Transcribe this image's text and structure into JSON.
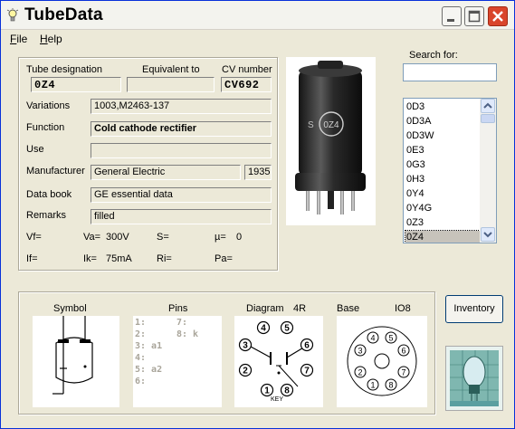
{
  "app": {
    "title": "TubeData"
  },
  "menu": {
    "file": "F",
    "file_rest": "ile",
    "help": "H",
    "help_rest": "elp"
  },
  "details": {
    "tube_designation_label": "Tube designation",
    "equivalent_label": "Equivalent to",
    "cv_label": "CV number",
    "tube_designation": "0Z4",
    "equivalent": "",
    "cv_number": "CV692",
    "variations_label": "Variations",
    "variations": "1003,M2463-137",
    "function_label": "Function",
    "function": "Cold cathode rectifier",
    "use_label": "Use",
    "use": "",
    "manufacturer_label": "Manufacturer",
    "manufacturer": "General Electric",
    "year": "1935",
    "databook_label": "Data book",
    "databook": "GE essential data",
    "remarks_label": "Remarks",
    "remarks": "filled",
    "vf": "Vf=",
    "va": "Va=",
    "va_val": "300V",
    "s": "S=",
    "mu": "µ=",
    "mu_val": "0",
    "if": "If=",
    "ik": "Ik=",
    "ik_val": "75mA",
    "ri": "Ri=",
    "pa": "Pa="
  },
  "search": {
    "label": "Search for:",
    "value": ""
  },
  "tube_list": {
    "items": [
      "0D3",
      "0D3A",
      "0D3W",
      "0E3",
      "0G3",
      "0H3",
      "0Y4",
      "0Y4G",
      "0Z3",
      "0Z4"
    ],
    "selected": "0Z4"
  },
  "bottom": {
    "symbol_label": "Symbol",
    "pins_label": "Pins",
    "diagram_label": "Diagram",
    "diagram_code": "4R",
    "base_label": "Base",
    "base_code": "IO8",
    "pins_left": [
      "1:",
      "2:",
      "3: a1",
      "4:",
      "5: a2",
      "6:"
    ],
    "pins_right": [
      "7:",
      "8: k"
    ],
    "diagram_pins": [
      "1",
      "2",
      "3",
      "4",
      "5",
      "6",
      "7",
      "8"
    ],
    "diagram_key": "KEY",
    "base_pins": [
      "1",
      "2",
      "3",
      "4",
      "5",
      "6",
      "7",
      "8"
    ]
  },
  "inventory_label": "Inventory",
  "photo_tube_text": [
    "S",
    "0Z4"
  ]
}
